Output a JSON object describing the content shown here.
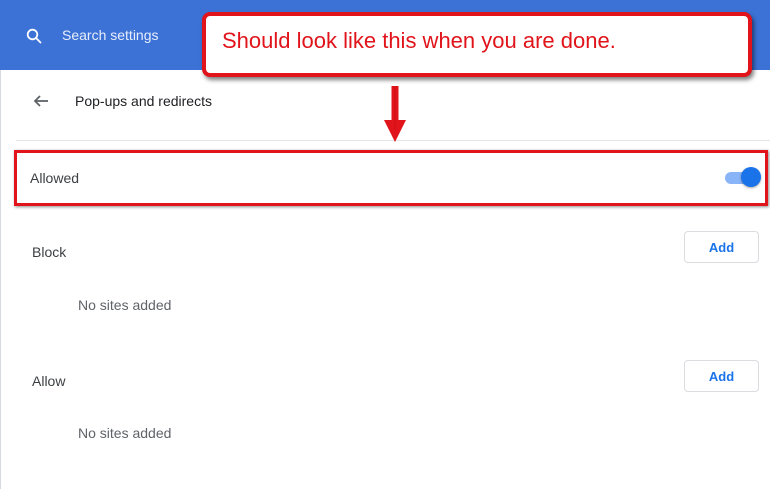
{
  "search": {
    "placeholder": "Search settings",
    "icon": "search-icon"
  },
  "header": {
    "back_icon": "arrow-left-icon",
    "title": "Pop-ups and redirects"
  },
  "allowed": {
    "label": "Allowed",
    "toggle_on": true
  },
  "block": {
    "label": "Block",
    "add_label": "Add",
    "empty": "No sites added"
  },
  "allow": {
    "label": "Allow",
    "add_label": "Add",
    "empty": "No sites added"
  },
  "callout": {
    "text": "Should look like this when you are done."
  },
  "colors": {
    "topbar": "#3c72d6",
    "accent": "#1a73e8",
    "annotation": "#e0141a"
  }
}
